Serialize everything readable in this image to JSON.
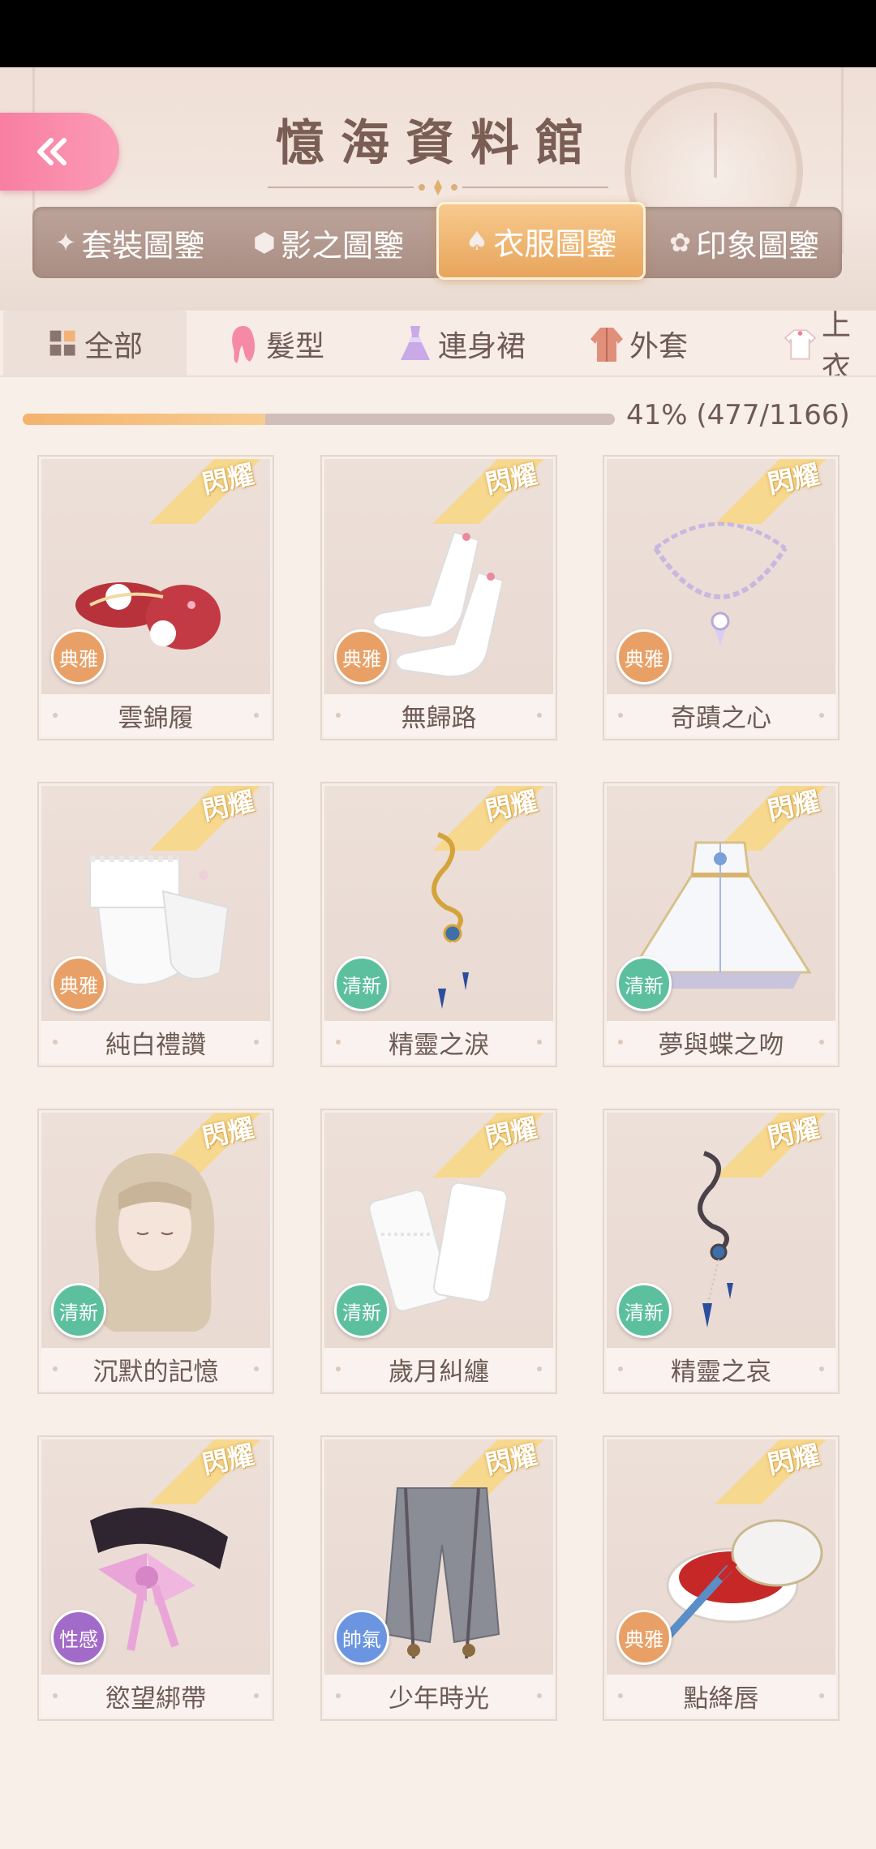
{
  "header": {
    "title": "憶海資料館",
    "back_icon": "double-chevron-left-icon"
  },
  "main_tabs": [
    {
      "label": "套裝圖鑒",
      "icon": "star-icon",
      "active": false
    },
    {
      "label": "影之圖鑒",
      "icon": "cube-icon",
      "active": false
    },
    {
      "label": "衣服圖鑒",
      "icon": "dress-icon",
      "active": true
    },
    {
      "label": "印象圖鑒",
      "icon": "flower-icon",
      "active": false
    }
  ],
  "categories": [
    {
      "label": "全部",
      "icon": "grid-icon",
      "active": true
    },
    {
      "label": "髮型",
      "icon": "hair-icon",
      "active": false
    },
    {
      "label": "連身裙",
      "icon": "dress-icon",
      "active": false
    },
    {
      "label": "外套",
      "icon": "coat-icon",
      "active": false
    },
    {
      "label": "上衣",
      "icon": "shirt-icon",
      "active": false
    }
  ],
  "progress": {
    "text": "41% (477/1166)",
    "fraction": 0.41
  },
  "ribbon_label": "閃耀",
  "items": [
    {
      "name": "雲錦履",
      "tag": "典雅",
      "art": "shoes"
    },
    {
      "name": "無歸路",
      "tag": "典雅",
      "art": "socks"
    },
    {
      "name": "奇蹟之心",
      "tag": "典雅",
      "art": "necklace"
    },
    {
      "name": "純白禮讚",
      "tag": "典雅",
      "art": "gloves"
    },
    {
      "name": "精靈之淚",
      "tag": "清新",
      "art": "earring-gold"
    },
    {
      "name": "夢與蝶之吻",
      "tag": "清新",
      "art": "gown"
    },
    {
      "name": "沉默的記憶",
      "tag": "清新",
      "art": "hair"
    },
    {
      "name": "歲月糾纏",
      "tag": "清新",
      "art": "lace-socks"
    },
    {
      "name": "精靈之哀",
      "tag": "清新",
      "art": "earring-dark"
    },
    {
      "name": "慾望綁帶",
      "tag": "性感",
      "art": "choker"
    },
    {
      "name": "少年時光",
      "tag": "帥氣",
      "art": "pants"
    },
    {
      "name": "點絳唇",
      "tag": "典雅",
      "art": "lipstick-jar"
    }
  ],
  "tag_colors": {
    "典雅": "#e8a066",
    "清新": "#5cbf9d",
    "性感": "#a36bc9",
    "帥氣": "#6b95e0"
  }
}
